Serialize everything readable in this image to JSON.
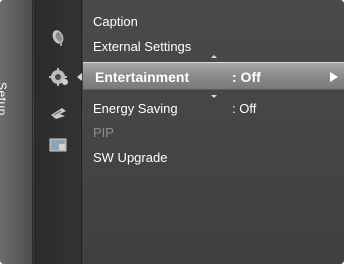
{
  "panel": {
    "vertical_label": "Setup"
  },
  "icons": [
    {
      "name": "satellite-dish-icon"
    },
    {
      "name": "gear-icon"
    },
    {
      "name": "energy-leaf-icon"
    },
    {
      "name": "pip-screen-icon"
    }
  ],
  "menu": {
    "items": [
      {
        "label": "Caption",
        "value": ""
      },
      {
        "label": "External Settings",
        "value": ""
      },
      {
        "label": "Entertainment",
        "value": ": Off",
        "selected": true
      },
      {
        "label": "Energy Saving",
        "value": ": Off"
      },
      {
        "label": "PIP",
        "value": "",
        "disabled": true
      },
      {
        "label": "SW Upgrade",
        "value": ""
      }
    ]
  },
  "colors": {
    "selected_bar": "#9a9a9a",
    "disabled_text": "#8d8d8d",
    "text": "#ffffff"
  }
}
